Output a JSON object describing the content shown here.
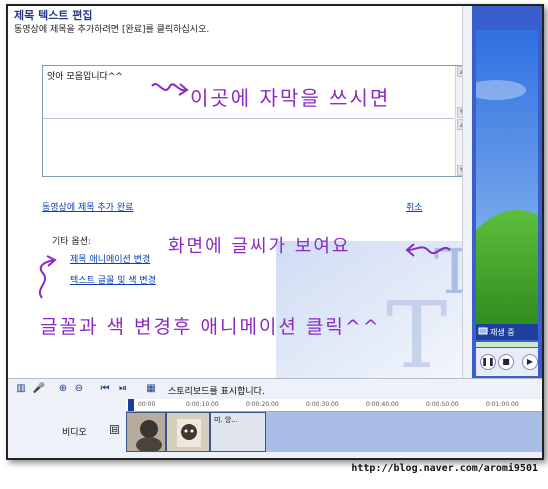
{
  "dialog": {
    "title": "제목 텍스트 편집",
    "instruction": "동영상에 제목을 추가하려면 [완료]를 클릭하십시오.",
    "text_value": "앗아 모음입니다^^",
    "done_link": "동영상에 제목 추가 완료",
    "cancel_link": "취소",
    "other_options_label": "기타 옵션:",
    "option_animation": "제목 애니메이션 변경",
    "option_font": "텍스트 글꼴 및 색 변경"
  },
  "preview": {
    "status": "재생 중",
    "play_icon": "pause-icon",
    "stop_icon": "stop-icon"
  },
  "storyboard": {
    "toggle_text": "스토리보드를 표시합니다.",
    "track_label": "비디오",
    "track_toggle": "⊟",
    "ruler_ticks": [
      "00:00",
      "0:00:10.00",
      "0:00:20.00",
      "0:00:30.00",
      "0:00:40.00",
      "0:00:50.00",
      "0:01:00.00"
    ],
    "clip_label": "미. 앙..."
  },
  "annotations": {
    "note1": "이곳에 자막을 쓰시면",
    "note2": "화면에 글씨가 보여요",
    "note3": "글꼴과 색 변경후 애니메이션 클릭^^"
  },
  "watermark": "http://blog.naver.com/aromi9501",
  "colors": {
    "link": "#0b3fb8",
    "handwriting": "#8b2bc4",
    "title": "#2a3a8a"
  }
}
